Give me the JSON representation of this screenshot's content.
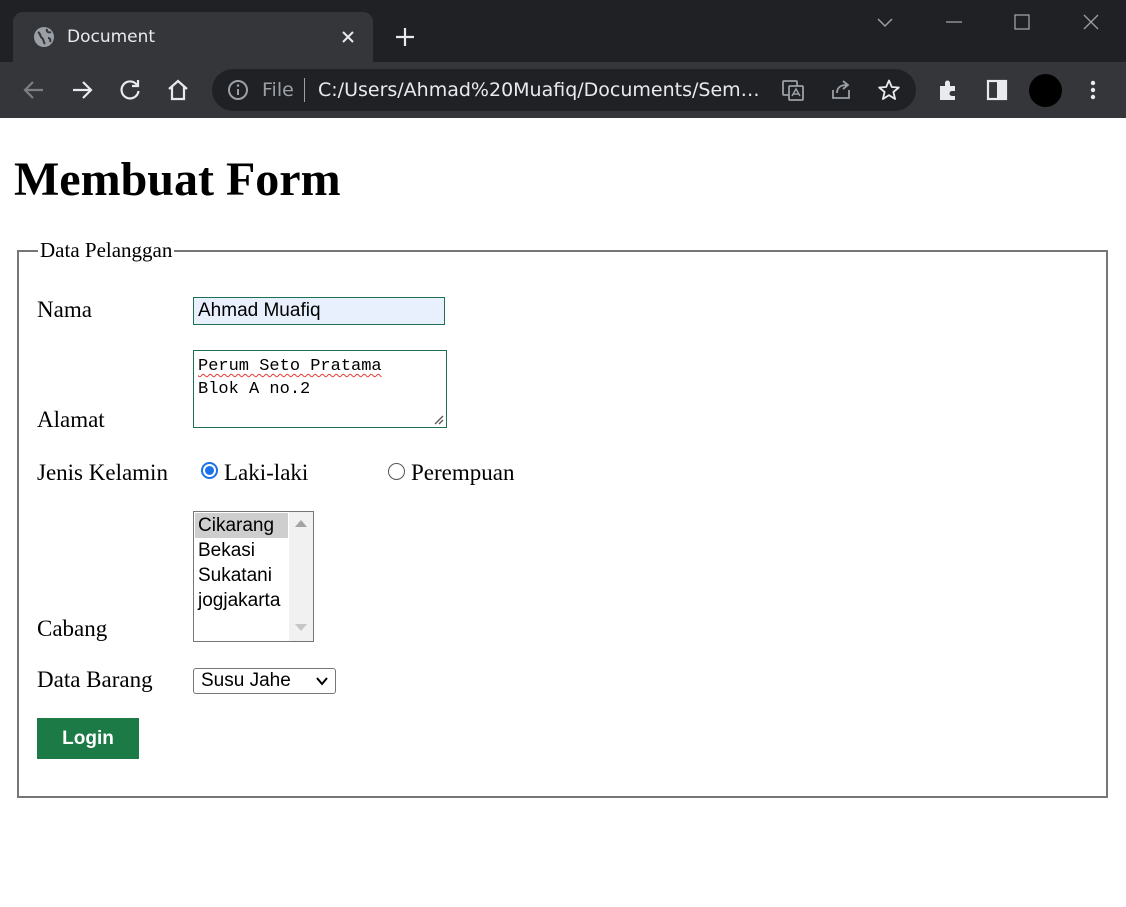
{
  "browser": {
    "tab_title": "Document",
    "omnibox_scheme": "File",
    "omnibox_url": "C:/Users/Ahmad%20Muafiq/Documents/Seme..."
  },
  "page": {
    "title": "Membuat Form",
    "legend": "Data Pelanggan",
    "fields": {
      "nama_label": "Nama",
      "nama_value": "Ahmad Muafiq",
      "alamat_label": "Alamat",
      "alamat_lines": [
        "Perum Seto Pratama",
        "Blok A no.2"
      ],
      "jenis_kelamin_label": "Jenis Kelamin",
      "gender_options": [
        {
          "label": "Laki-laki",
          "checked": true
        },
        {
          "label": "Perempuan",
          "checked": false
        }
      ],
      "cabang_label": "Cabang",
      "cabang_options": [
        "Cikarang",
        "Bekasi",
        "Sukatani",
        "jogjakarta"
      ],
      "cabang_selected": "Cikarang",
      "data_barang_label": "Data Barang",
      "data_barang_value": "Susu Jahe"
    },
    "login_button": "Login"
  },
  "colors": {
    "chrome_dark": "#202124",
    "chrome_toolbar": "#35363a",
    "radio_accent": "#1a73e8",
    "autofill_bg": "#e8f0fe",
    "login_bg": "#1b7a46"
  },
  "icons": [
    "globe-icon",
    "close-icon",
    "plus-icon",
    "chevron-down-icon",
    "minimize-icon",
    "maximize-icon",
    "window-close-icon",
    "back-icon",
    "forward-icon",
    "reload-icon",
    "home-icon",
    "info-icon",
    "translate-icon",
    "share-icon",
    "star-icon",
    "extensions-icon",
    "sidepanel-icon"
  ]
}
